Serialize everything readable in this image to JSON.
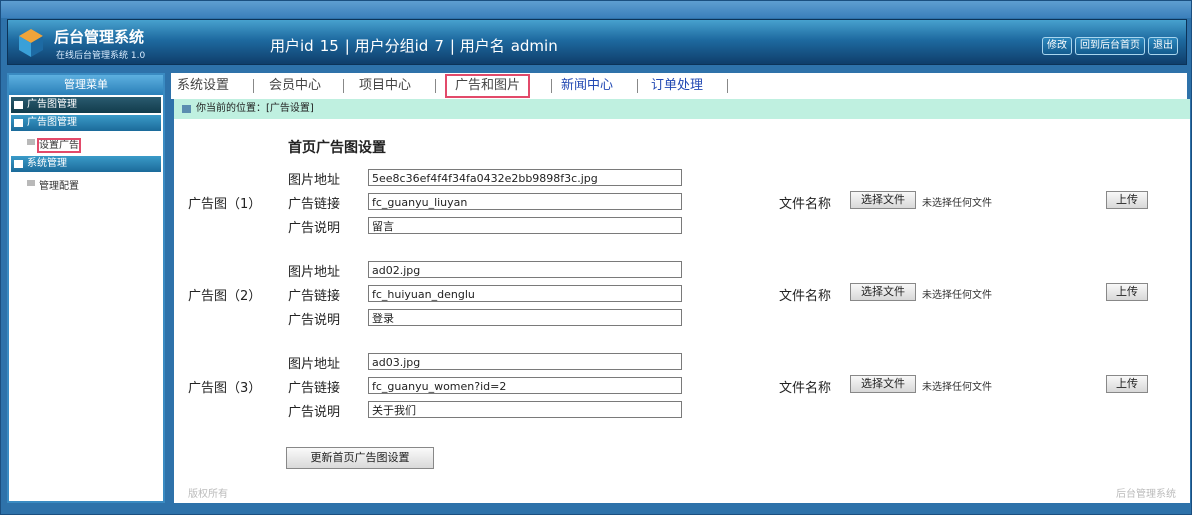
{
  "header": {
    "app_title": "后台管理系统",
    "app_subtitle": "在线后台管理系统 1.0",
    "userinfo": {
      "uid_label": "用户id",
      "uid": "15",
      "group_label": "用户分组id",
      "group": "7",
      "name_label": "用户名",
      "name": "admin"
    },
    "buttons": [
      "修改",
      "回到后台首页",
      "退出"
    ]
  },
  "sidebar": {
    "head": "管理菜单",
    "sections": [
      {
        "label": "广告图管理",
        "items": []
      },
      {
        "label": "广告图管理",
        "items": [
          "设置广告"
        ]
      },
      {
        "label": "系统管理",
        "items": [
          "管理配置"
        ]
      }
    ]
  },
  "tabs": [
    "系统设置",
    "会员中心",
    "项目中心",
    "广告和图片",
    "新闻中心",
    "订单处理"
  ],
  "breadcrumb": "你当前的位置：[广告设置]",
  "section_title": "首页广告图设置",
  "field_labels": {
    "img": "图片地址",
    "link": "广告链接",
    "desc": "广告说明"
  },
  "file_label": "文件名称",
  "choose_label": "选择文件",
  "no_file_text": "未选择任何文件",
  "upload_label": "上传",
  "ads": [
    {
      "label": "广告图（1）",
      "img": "5ee8c36ef4f4f34fa0432e2bb9898f3c.jpg",
      "link": "fc_guanyu_liuyan",
      "desc": "留言"
    },
    {
      "label": "广告图（2）",
      "img": "ad02.jpg",
      "link": "fc_huiyuan_denglu",
      "desc": "登录"
    },
    {
      "label": "广告图（3）",
      "img": "ad03.jpg",
      "link": "fc_guanyu_women?id=2",
      "desc": "关于我们"
    }
  ],
  "update_button": "更新首页广告图设置",
  "footer_left": "版权所有",
  "footer_right": "后台管理系统"
}
